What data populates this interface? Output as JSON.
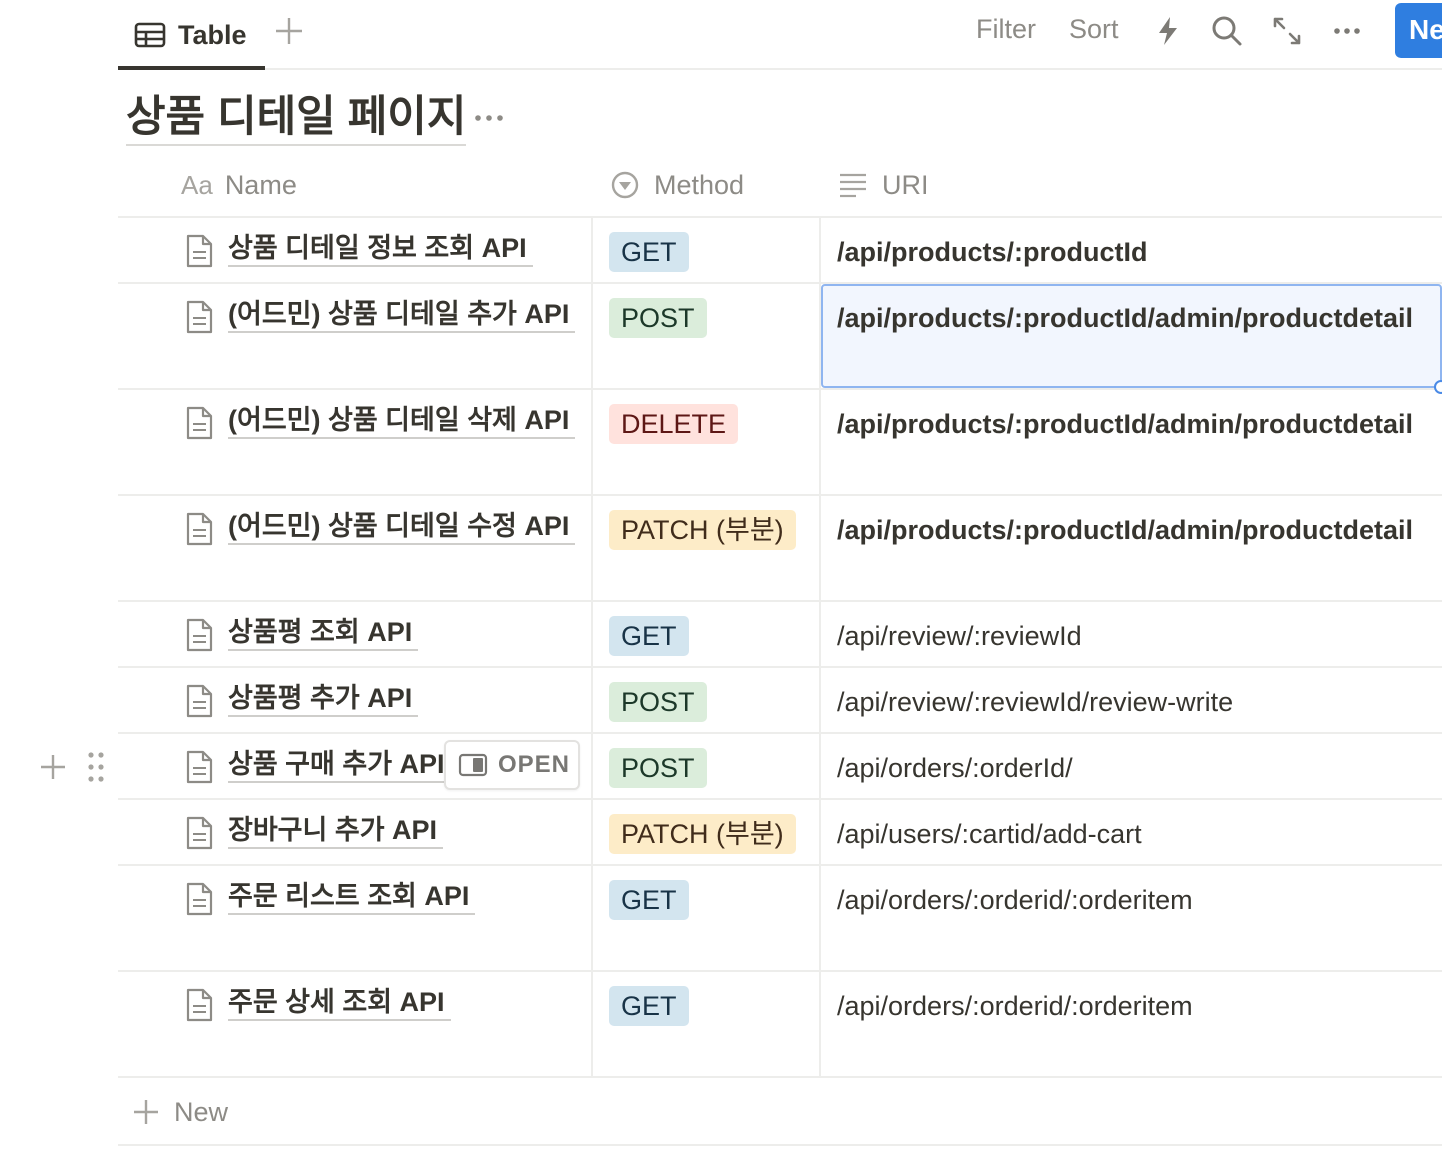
{
  "toolbar": {
    "view_tab_label": "Table",
    "filter_label": "Filter",
    "sort_label": "Sort",
    "new_button_label": "New"
  },
  "database": {
    "title": "상품 디테일 페이지"
  },
  "columns": {
    "name": {
      "prefix": "Aa",
      "label": "Name"
    },
    "method": {
      "label": "Method"
    },
    "uri": {
      "label": "URI"
    }
  },
  "rows": [
    {
      "name": "상품 디테일 정보 조회 API",
      "method": "GET",
      "uri": "/api/products/:productId",
      "uri_bold": true
    },
    {
      "name": "(어드민) 상품 디테일 추가 API",
      "method": "POST",
      "uri": "/api/products/:productId/admin/productdetail",
      "uri_bold": true,
      "selected": true
    },
    {
      "name": "(어드민) 상품 디테일 삭제 API",
      "method": "DELETE",
      "uri": "/api/products/:productId/admin/productdetail",
      "uri_bold": true
    },
    {
      "name": "(어드민) 상품 디테일 수정 API",
      "method": "PATCH (부분)",
      "uri": "/api/products/:productId/admin/productdetail",
      "uri_bold": true
    },
    {
      "name": "상품평 조회 API",
      "method": "GET",
      "uri": "/api/review/:reviewId"
    },
    {
      "name": "상품평 추가 API",
      "method": "POST",
      "uri": "/api/review/:reviewId/review-write"
    },
    {
      "name": "상품 구매 추가 API",
      "method": "POST",
      "uri": "/api/orders/:orderId/",
      "hovered": true,
      "open_label": "OPEN"
    },
    {
      "name": "장바구니 추가 API",
      "method": "PATCH (부분)",
      "uri": "/api/users/:cartid/add-cart"
    },
    {
      "name": "주문 리스트 조회 API",
      "method": "GET",
      "uri": "/api/orders/:orderid/:orderitem"
    },
    {
      "name": "주문 상세 조회 API",
      "method": "GET",
      "uri": "/api/orders/:orderid/:orderitem"
    }
  ],
  "footer": {
    "new_row_label": "New"
  },
  "colors": {
    "accent": "#2f7ee0",
    "tag_get": "#d3e5ef",
    "tag_post": "#dbeddb",
    "tag_delete": "#ffe2dd",
    "tag_patch": "#fdecc8"
  },
  "icons": [
    "table-icon",
    "plus-icon",
    "lightning-icon",
    "search-icon",
    "expand-icon",
    "more-icon",
    "page-icon",
    "select-icon",
    "text-lines-icon",
    "open-panel-icon",
    "drag-handle-icon"
  ]
}
